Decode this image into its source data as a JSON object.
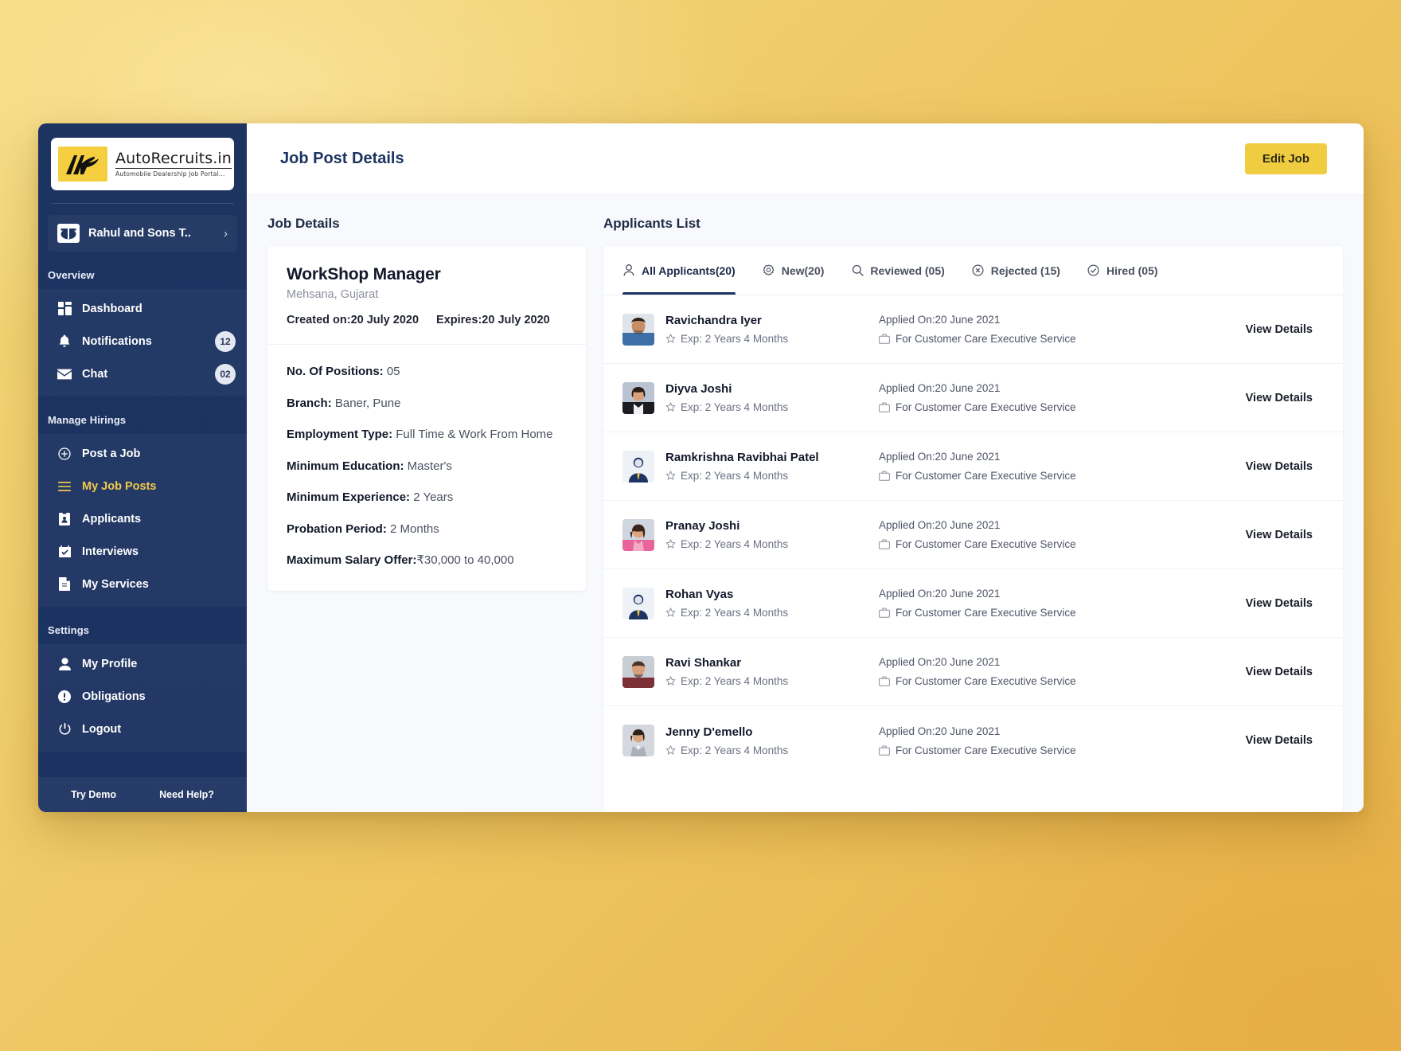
{
  "brand": {
    "name": "AutoRecruits.in",
    "tagline": "Automobile Dealership Job Portal..."
  },
  "sidebar": {
    "org": {
      "name": "Rahul and Sons T..",
      "chevron": "›"
    },
    "sections": [
      {
        "title": "Overview",
        "items": [
          {
            "label": "Dashboard",
            "icon": "dashboard-icon",
            "badge": ""
          },
          {
            "label": "Notifications",
            "icon": "bell-icon",
            "badge": "12"
          },
          {
            "label": "Chat",
            "icon": "envelope-icon",
            "badge": "02"
          }
        ]
      },
      {
        "title": "Manage Hirings",
        "items": [
          {
            "label": "Post a Job",
            "icon": "plus-circle-icon",
            "badge": ""
          },
          {
            "label": "My Job Posts",
            "icon": "list-icon",
            "badge": "",
            "active": true
          },
          {
            "label": "Applicants",
            "icon": "id-card-icon",
            "badge": ""
          },
          {
            "label": "Interviews",
            "icon": "calendar-check-icon",
            "badge": ""
          },
          {
            "label": "My Services",
            "icon": "document-icon",
            "badge": ""
          }
        ]
      },
      {
        "title": "Settings",
        "items": [
          {
            "label": "My Profile",
            "icon": "user-icon",
            "badge": ""
          },
          {
            "label": "Obligations",
            "icon": "exclamation-circle-icon",
            "badge": ""
          },
          {
            "label": "Logout",
            "icon": "power-icon",
            "badge": ""
          }
        ]
      }
    ],
    "footer": {
      "demo": "Try Demo",
      "help": "Need Help?"
    }
  },
  "header": {
    "title": "Job Post Details",
    "edit_button": "Edit Job"
  },
  "job_details": {
    "heading": "Job Details",
    "title": "WorkShop Manager",
    "location": "Mehsana, Gujarat",
    "created_label": "Created on:",
    "created_value": "20 July 2020",
    "expires_label": "Expires:",
    "expires_value": "20 July 2020",
    "fields": [
      {
        "key": "No. Of Positions:",
        "value": "05"
      },
      {
        "key": "Branch:",
        "value": "Baner, Pune"
      },
      {
        "key": "Employment Type:",
        "value": "Full Time & Work From Home"
      },
      {
        "key": "Minimum Education:",
        "value": "Master's"
      },
      {
        "key": "Minimum Experience:",
        "value": "2 Years"
      },
      {
        "key": "Probation Period:",
        "value": "2 Months"
      },
      {
        "key": "Maximum Salary Offer:",
        "value": "₹30,000 to 40,000"
      }
    ]
  },
  "applicants": {
    "heading": "Applicants List",
    "tabs": [
      {
        "label": "All Applicants(20)",
        "icon": "user-icon",
        "active": true
      },
      {
        "label": "New(20)",
        "icon": "gear-icon",
        "active": false
      },
      {
        "label": "Reviewed (05)",
        "icon": "search-icon",
        "active": false
      },
      {
        "label": "Rejected (15)",
        "icon": "x-circle-icon",
        "active": false
      },
      {
        "label": "Hired (05)",
        "icon": "check-circle-icon",
        "active": false
      }
    ],
    "view_details_label": "View Details",
    "rows": [
      {
        "name": "Ravichandra Iyer",
        "exp": "Exp: 2 Years 4 Months",
        "applied": "Applied On:20 June 2021",
        "service": "For Customer Care Executive Service",
        "avatar": "photo-male-blue"
      },
      {
        "name": "Diyva Joshi",
        "exp": "Exp: 2 Years 4 Months",
        "applied": "Applied On:20 June 2021",
        "service": "For Customer Care Executive Service",
        "avatar": "photo-female-black"
      },
      {
        "name": "Ramkrishna Ravibhai Patel",
        "exp": "Exp: 2 Years 4 Months",
        "applied": "Applied On:20 June 2021",
        "service": "For Customer Care Executive Service",
        "avatar": "placeholder-male"
      },
      {
        "name": "Pranay Joshi",
        "exp": "Exp: 2 Years 4 Months",
        "applied": "Applied On:20 June 2021",
        "service": "For Customer Care Executive Service",
        "avatar": "photo-female-pink"
      },
      {
        "name": "Rohan Vyas",
        "exp": "Exp: 2 Years 4 Months",
        "applied": "Applied On:20 June 2021",
        "service": "For Customer Care Executive Service",
        "avatar": "placeholder-male"
      },
      {
        "name": "Ravi Shankar",
        "exp": "Exp: 2 Years 4 Months",
        "applied": "Applied On:20 June 2021",
        "service": "For Customer Care Executive Service",
        "avatar": "photo-male-maroon"
      },
      {
        "name": "Jenny D'emello",
        "exp": "Exp: 2 Years 4 Months",
        "applied": "Applied On:20 June 2021",
        "service": "For Customer Care Executive Service",
        "avatar": "photo-female-grey"
      }
    ]
  },
  "colors": {
    "sidebar": "#1d3461",
    "accent_yellow": "#f0cd40",
    "page_bg": "#f7f9fc",
    "active_nav": "#f2c94c"
  }
}
